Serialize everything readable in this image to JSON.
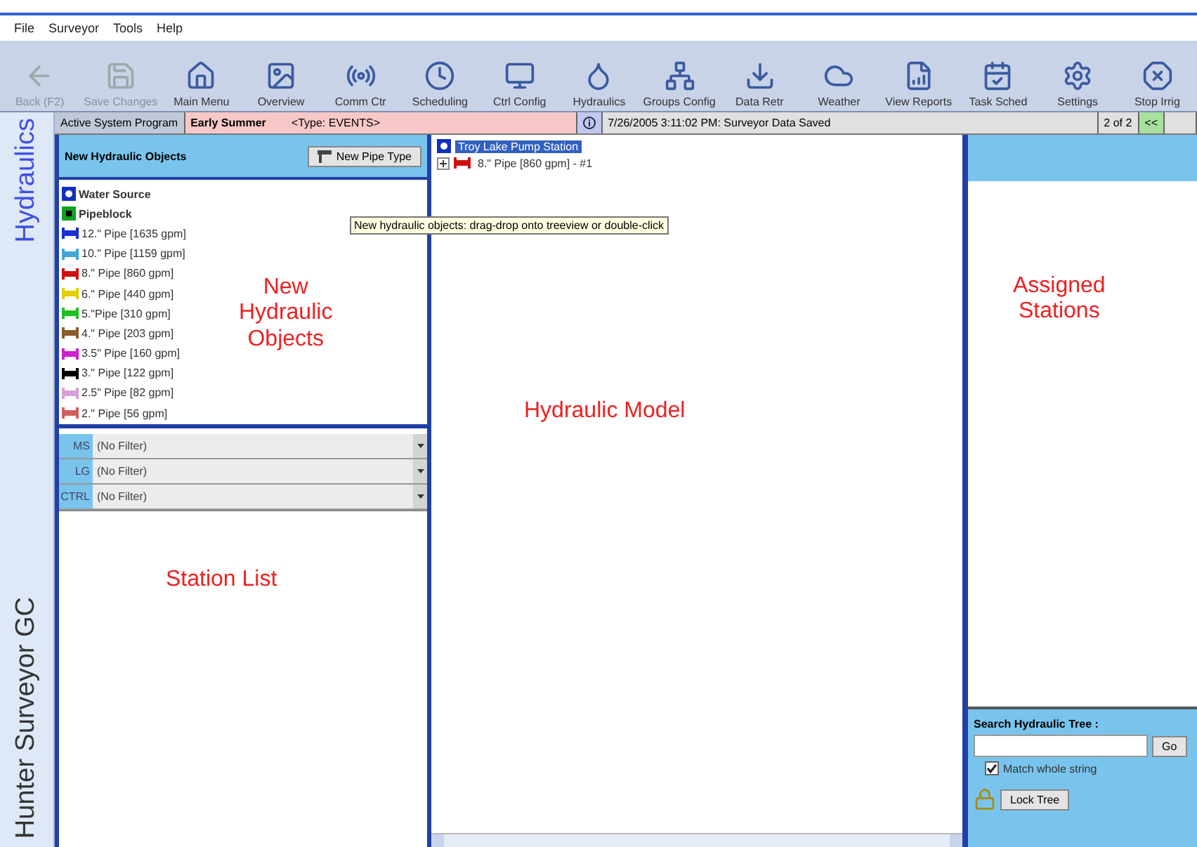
{
  "menu": [
    "File",
    "Surveyor",
    "Tools",
    "Help"
  ],
  "toolbar": [
    {
      "label": "Back (F2)",
      "disabled": true
    },
    {
      "label": "Save Changes",
      "disabled": true
    },
    {
      "label": "Main Menu",
      "disabled": false
    },
    {
      "label": "Overview",
      "disabled": false
    },
    {
      "label": "Comm Ctr",
      "disabled": false
    },
    {
      "label": "Scheduling",
      "disabled": false
    },
    {
      "label": "Ctrl Config",
      "disabled": false
    },
    {
      "label": "Hydraulics",
      "disabled": false
    },
    {
      "label": "Groups Config",
      "disabled": false
    },
    {
      "label": "Data Retr",
      "disabled": false
    },
    {
      "label": "Weather",
      "disabled": false
    },
    {
      "label": "View Reports",
      "disabled": false
    },
    {
      "label": "Task Sched",
      "disabled": false
    },
    {
      "label": "Settings",
      "disabled": false
    },
    {
      "label": "Stop Irrig",
      "disabled": false
    }
  ],
  "status": {
    "program_label": "Active System Program",
    "program": "Early Summer",
    "program_type": "<Type: EVENTS>",
    "message": "7/26/2005 3:11:02 PM: Surveyor Data Saved",
    "page": "2 of 2",
    "prev": "<<"
  },
  "sidebar": {
    "top": "Hydraulics",
    "bottom": "Hunter Surveyor GC"
  },
  "objects_panel": {
    "title": "New Hydraulic Objects",
    "button": "New Pipe Type",
    "annotation": "New Hydraulic Objects",
    "items": [
      {
        "kind": "source",
        "label": "Water Source",
        "color": "#1030c0"
      },
      {
        "kind": "block",
        "label": "Pipeblock",
        "color": "#10a020"
      },
      {
        "kind": "pipe",
        "label": "12.\" Pipe [1635 gpm]",
        "color": "#1a2fd0"
      },
      {
        "kind": "pipe",
        "label": "10.\" Pipe [1159 gpm]",
        "color": "#3fa6d8"
      },
      {
        "kind": "pipe",
        "label": "8.\" Pipe [860 gpm]",
        "color": "#d01010"
      },
      {
        "kind": "pipe",
        "label": "6.\" Pipe [440 gpm]",
        "color": "#e0d000"
      },
      {
        "kind": "pipe",
        "label": "5.\"Pipe [310 gpm]",
        "color": "#20c020"
      },
      {
        "kind": "pipe",
        "label": "4.\" Pipe [203 gpm]",
        "color": "#8b5a2b"
      },
      {
        "kind": "pipe",
        "label": "3.5\" Pipe [160 gpm]",
        "color": "#d020d0"
      },
      {
        "kind": "pipe",
        "label": "3.\" Pipe [122 gpm]",
        "color": "#000000"
      },
      {
        "kind": "pipe",
        "label": "2.5\" Pipe [82 gpm]",
        "color": "#d8a0d8"
      },
      {
        "kind": "pipe",
        "label": "2.\" Pipe [56 gpm]",
        "color": "#d06060"
      }
    ]
  },
  "filters": [
    {
      "label": "MS",
      "value": "(No Filter)"
    },
    {
      "label": "LG",
      "value": "(No Filter)"
    },
    {
      "label": "CTRL",
      "value": "(No Filter)"
    }
  ],
  "station_list": {
    "annotation": "Station List"
  },
  "tree": {
    "annotation": "Hydraulic Model",
    "tooltip": "New hydraulic objects: drag-drop onto treeview or double-click",
    "nodes": [
      {
        "kind": "source",
        "label": "Troy Lake Pump Station",
        "selected": true,
        "color": "#1030c0",
        "children": [
          {
            "kind": "pipe",
            "label": "8.\" Pipe [860 gpm] - #1",
            "selected": false,
            "expanded": false,
            "color": "#d01010"
          }
        ]
      }
    ]
  },
  "assigned": {
    "annotation": "Assigned Stations",
    "search_label": "Search Hydraulic Tree :",
    "go": "Go",
    "match": {
      "label": "Match whole string",
      "checked": true
    },
    "lock": "Lock Tree"
  }
}
